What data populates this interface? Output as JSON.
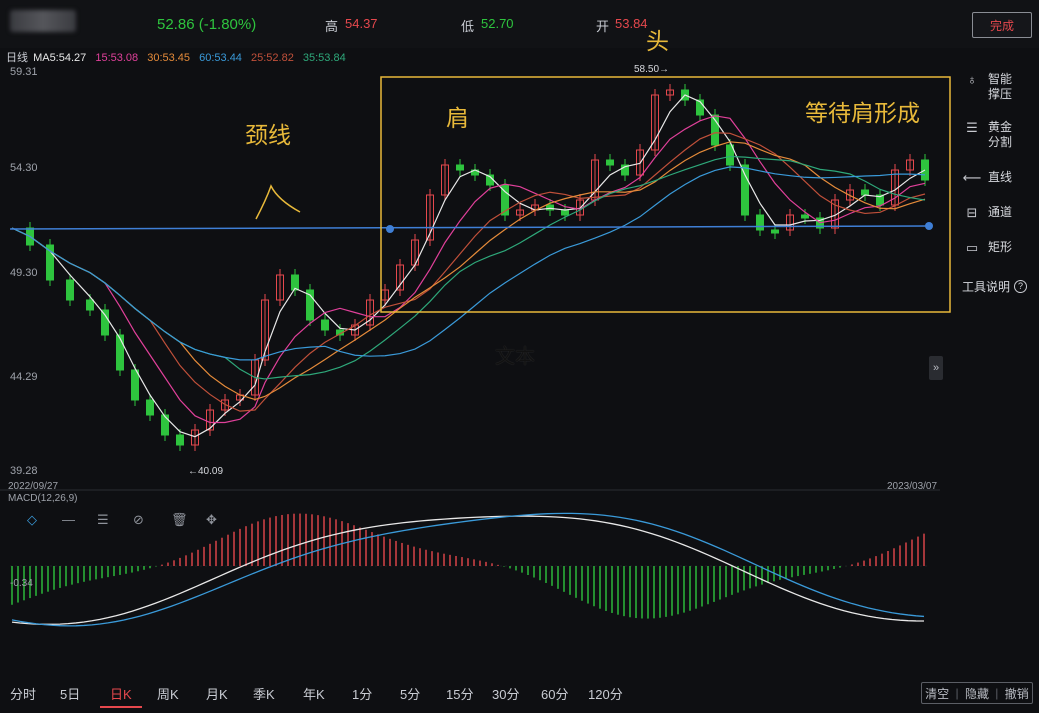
{
  "header": {
    "price": "52.86 (-1.80%)",
    "high_label": "高",
    "high_value": "54.37",
    "low_label": "低",
    "low_value": "52.70",
    "open_label": "开",
    "open_value": "53.84",
    "done_button": "完成"
  },
  "ma_legend": {
    "period": "日线",
    "ma5": "MA5:54.27",
    "ma15": "15:53.08",
    "ma30": "30:53.45",
    "ma60": "60:53.44",
    "ma25": "25:52.82",
    "ma35": "35:53.84"
  },
  "colors": {
    "up": "#e5484d",
    "down": "#2ec43e",
    "ma5": "#e8e8e8",
    "ma15": "#e0409a",
    "ma30": "#e58b3a",
    "ma60": "#3a9ad9",
    "ma25": "#c0503a",
    "ma35": "#2ea87a",
    "annotation": "#e8b93a",
    "neckline": "#3f7fd6"
  },
  "y_axis": {
    "top": "59.31",
    "mid1": "54.30",
    "mid2": "49.30",
    "mid3": "44.29",
    "bottom": "39.28"
  },
  "markers": {
    "high": "58.50→",
    "low": "←40.09"
  },
  "dates": {
    "start": "2022/09/27",
    "end": "2023/03/07"
  },
  "macd": {
    "label": "MACD(12,26,9)",
    "value": "-0.34"
  },
  "annotations": {
    "neckline": "颈线",
    "shoulder": "肩",
    "head": "头",
    "waiting": "等待肩形成",
    "text": "文本"
  },
  "right_tools": [
    {
      "icon": "bulb-icon",
      "glyph": "♁",
      "label": "智能撑压"
    },
    {
      "icon": "golden-ratio-icon",
      "glyph": "☰",
      "label": "黄金分割"
    },
    {
      "icon": "line-icon",
      "glyph": "⟵",
      "label": "直线"
    },
    {
      "icon": "channel-icon",
      "glyph": "⊟",
      "label": "通道"
    },
    {
      "icon": "rect-icon",
      "glyph": "▭",
      "label": "矩形"
    }
  ],
  "tools_help": "工具说明",
  "periods": [
    "分时",
    "5日",
    "日K",
    "周K",
    "月K",
    "季K",
    "年K",
    "1分",
    "5分",
    "15分",
    "30分",
    "60分",
    "120分"
  ],
  "active_period": "日K",
  "bottom_actions": [
    "清空",
    "隐藏",
    "撤销"
  ]
}
